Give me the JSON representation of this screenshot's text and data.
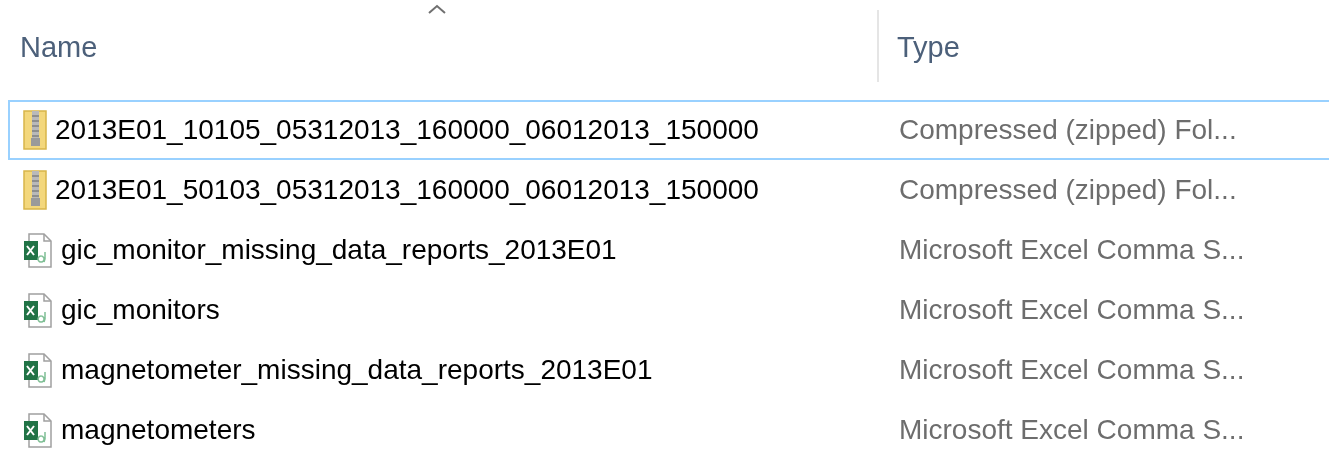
{
  "columns": [
    {
      "label": "Name",
      "sorted": true
    },
    {
      "label": "Type",
      "sorted": false
    }
  ],
  "rows": [
    {
      "kind": "zip",
      "name": "2013E01_10105_05312013_160000_06012013_150000",
      "type": "Compressed (zipped) Fol...",
      "focused": true
    },
    {
      "kind": "zip",
      "name": "2013E01_50103_05312013_160000_06012013_150000",
      "type": "Compressed (zipped) Fol...",
      "focused": false
    },
    {
      "kind": "csv",
      "name": "gic_monitor_missing_data_reports_2013E01",
      "type": "Microsoft Excel Comma S...",
      "focused": false
    },
    {
      "kind": "csv",
      "name": "gic_monitors",
      "type": "Microsoft Excel Comma S...",
      "focused": false
    },
    {
      "kind": "csv",
      "name": "magnetometer_missing_data_reports_2013E01",
      "type": "Microsoft Excel Comma S...",
      "focused": false
    },
    {
      "kind": "csv",
      "name": "magnetometers",
      "type": "Microsoft Excel Comma S...",
      "focused": false
    }
  ]
}
